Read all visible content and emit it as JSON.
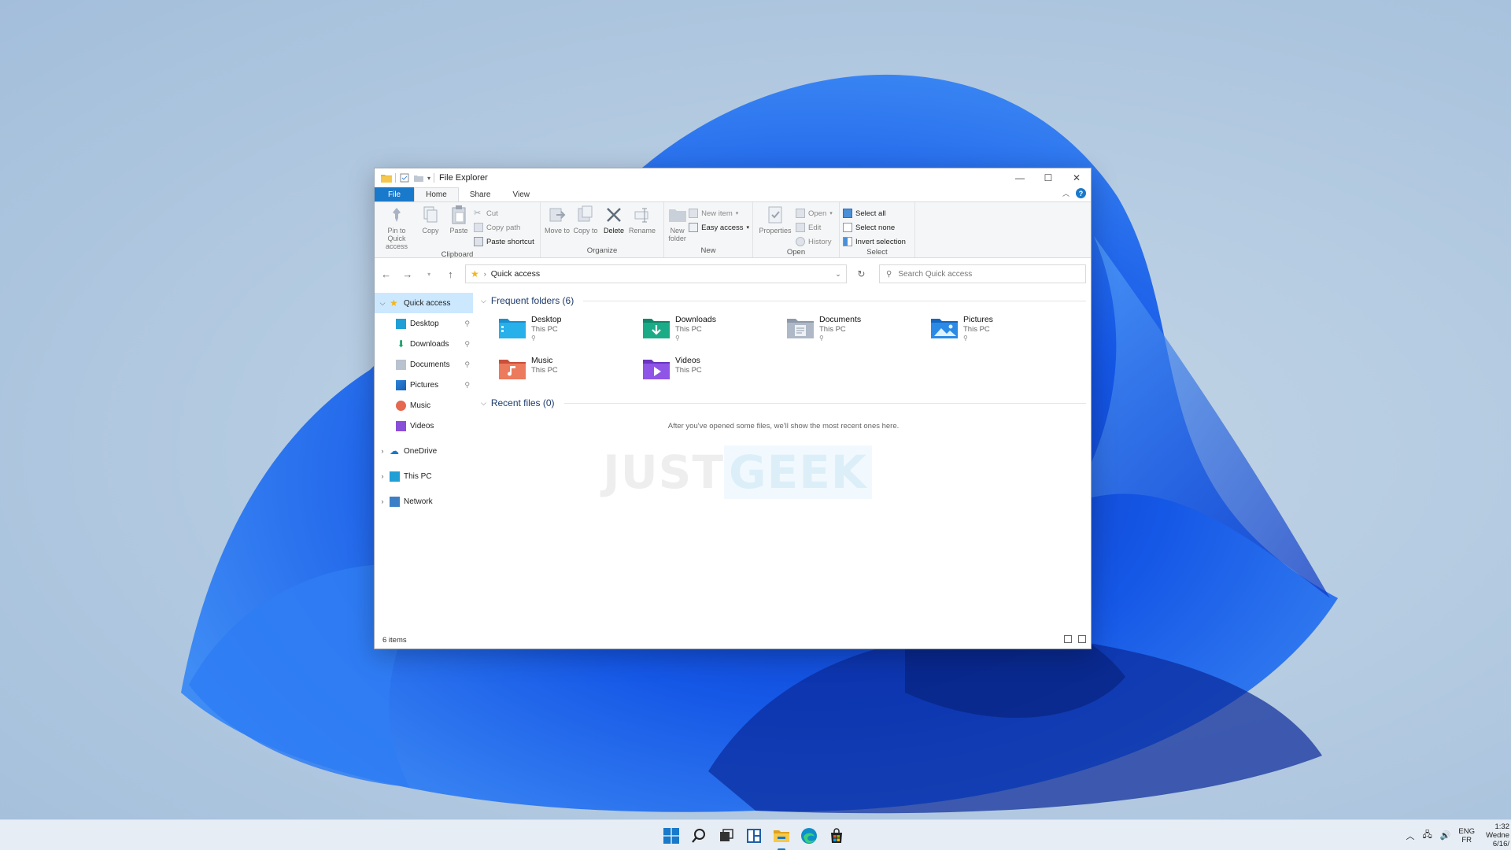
{
  "window": {
    "title": "File Explorer",
    "controls": {
      "minimize": "—",
      "maximize": "☐",
      "close": "✕"
    }
  },
  "ribbon_tabs": [
    "File",
    "Home",
    "Share",
    "View"
  ],
  "ribbon": {
    "clipboard": {
      "label": "Clipboard",
      "pin": "Pin to Quick access",
      "copy": "Copy",
      "paste": "Paste",
      "cut": "Cut",
      "copy_path": "Copy path",
      "paste_shortcut": "Paste shortcut"
    },
    "organize": {
      "label": "Organize",
      "move_to": "Move to",
      "copy_to": "Copy to",
      "delete": "Delete",
      "rename": "Rename"
    },
    "new": {
      "label": "New",
      "new_folder": "New folder",
      "new_item": "New item",
      "easy_access": "Easy access"
    },
    "open": {
      "label": "Open",
      "properties": "Properties",
      "open": "Open",
      "edit": "Edit",
      "history": "History"
    },
    "select": {
      "label": "Select",
      "select_all": "Select all",
      "select_none": "Select none",
      "invert": "Invert selection"
    }
  },
  "address": {
    "path": "Quick access",
    "search_placeholder": "Search Quick access"
  },
  "nav_pane": {
    "quick_access": "Quick access",
    "pinned": [
      "Desktop",
      "Downloads",
      "Documents",
      "Pictures",
      "Music",
      "Videos"
    ],
    "onedrive": "OneDrive",
    "this_pc": "This PC",
    "network": "Network"
  },
  "content": {
    "frequent_header": "Frequent folders (6)",
    "folders": [
      {
        "name": "Desktop",
        "location": "This PC",
        "pinned": true
      },
      {
        "name": "Downloads",
        "location": "This PC",
        "pinned": true
      },
      {
        "name": "Documents",
        "location": "This PC",
        "pinned": true
      },
      {
        "name": "Pictures",
        "location": "This PC",
        "pinned": true
      },
      {
        "name": "Music",
        "location": "This PC",
        "pinned": false
      },
      {
        "name": "Videos",
        "location": "This PC",
        "pinned": false
      }
    ],
    "recent_header": "Recent files (0)",
    "recent_empty": "After you've opened some files, we'll show the most recent ones here."
  },
  "watermark": {
    "part1": "JUST",
    "part2": "GEEK"
  },
  "status": {
    "items": "6 items"
  },
  "taskbar": {
    "lang1": "ENG",
    "lang2": "FR",
    "time": "1:32",
    "day": "Wedne",
    "date": "6/16/"
  },
  "colors": {
    "accent": "#1979ca",
    "selection": "#cce8ff",
    "wallpaper_blue": "#1a5ee0"
  }
}
